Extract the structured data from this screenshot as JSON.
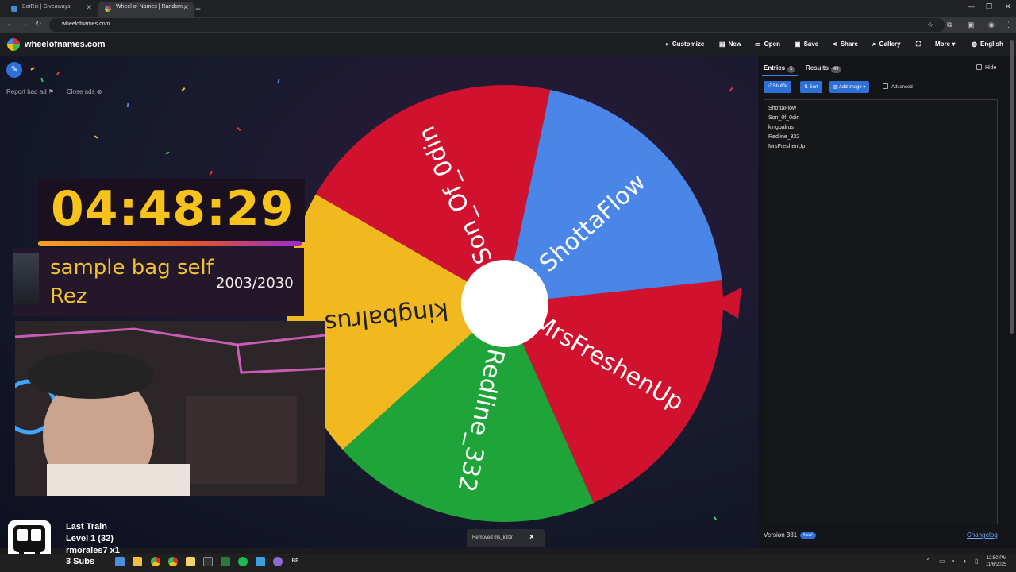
{
  "browser": {
    "tabs": [
      {
        "title": "BotRix | Giveaways"
      },
      {
        "title": "Wheel of Names | Random..."
      }
    ],
    "url": "wheelofnames.com"
  },
  "site": {
    "name": "wheelofnames.com",
    "nav": {
      "customize": "Customize",
      "new": "New",
      "open": "Open",
      "save": "Save",
      "share": "Share",
      "gallery": "Gallery",
      "more": "More",
      "language": "English"
    }
  },
  "ads": {
    "report": "Report bad ad",
    "close": "Close ads"
  },
  "wheel": {
    "segments": [
      {
        "name": "ShottaFlow",
        "color": "#4a86e8"
      },
      {
        "name": "MrsFreshenUp",
        "color": "#d0122f"
      },
      {
        "name": "Redline_332",
        "color": "#1fa43a"
      },
      {
        "name": "kingbalrus",
        "color": "#f2b820"
      },
      {
        "name": "Son_Of_0din",
        "color": "#d0122f"
      }
    ],
    "pointer_color": "#d0122f"
  },
  "panel": {
    "entries_tab": "Entries",
    "entries_count": "5",
    "results_tab": "Results",
    "results_count": "49",
    "hide_label": "Hide",
    "shuffle": "Shuffle",
    "sort": "Sort",
    "add_image": "Add image",
    "advanced": "Advanced",
    "entries": [
      "ShottaFlow",
      "Son_0f_0din",
      "kingbalrus",
      "Redline_332",
      "MrsFreshenUp"
    ],
    "version": "Version 381",
    "new_badge": "New!",
    "changelog": "Changelog"
  },
  "overlay": {
    "timer": "04:48:29",
    "goal_title": "sample bag self",
    "goal_name": "Rez",
    "goal_count": "2003/2030",
    "alert_lines": [
      "Last Train",
      "Level 1  (32)",
      "rmorales7 x1",
      "3 Subs"
    ]
  },
  "toast": {
    "message": "Removed ms_kill3r",
    "close": "×"
  },
  "taskbar": {
    "time": "12:50 PM",
    "date": "11/6/2025"
  }
}
